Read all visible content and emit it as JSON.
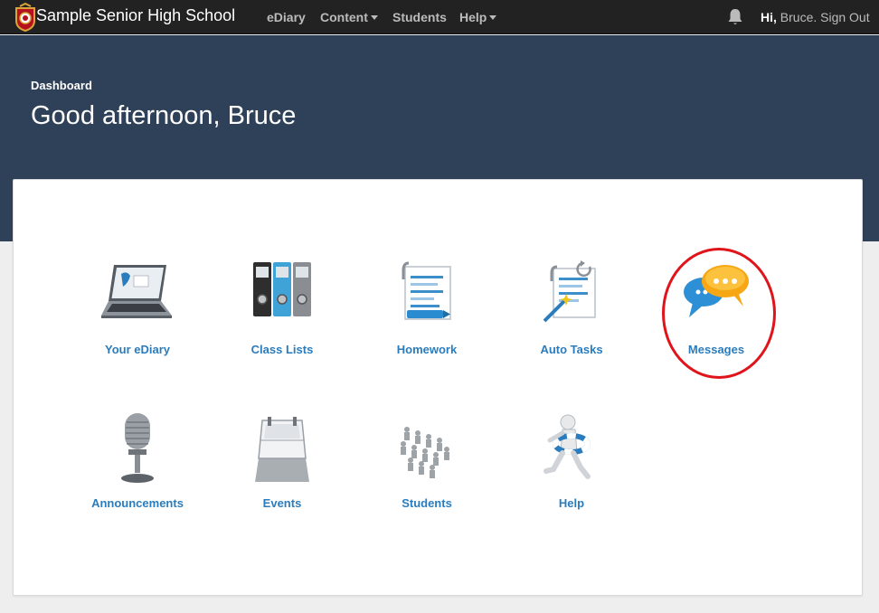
{
  "navbar": {
    "brand": "Sample Senior High School",
    "items": [
      {
        "label": "eDiary",
        "has_caret": false
      },
      {
        "label": "Content",
        "has_caret": true
      },
      {
        "label": "Students",
        "has_caret": false
      },
      {
        "label": "Help",
        "has_caret": true
      }
    ],
    "bell_icon": "bell-icon",
    "greeting_hi": "Hi,",
    "greeting_rest": " Bruce. Sign Out"
  },
  "header": {
    "breadcrumb": "Dashboard",
    "title": "Good afternoon, Bruce"
  },
  "tiles": [
    {
      "label": "Your eDiary",
      "icon": "laptop-icon"
    },
    {
      "label": "Class Lists",
      "icon": "binders-icon"
    },
    {
      "label": "Homework",
      "icon": "document-highlighter-icon"
    },
    {
      "label": "Auto Tasks",
      "icon": "document-wand-icon"
    },
    {
      "label": "Messages",
      "icon": "speech-bubbles-icon"
    },
    {
      "label": "Announcements",
      "icon": "microphone-icon"
    },
    {
      "label": "Events",
      "icon": "flip-calendar-icon"
    },
    {
      "label": "Students",
      "icon": "people-group-icon"
    },
    {
      "label": "Help",
      "icon": "lifebuoy-runner-icon"
    }
  ],
  "colors": {
    "navbar": "#222222",
    "header": "#2f4158",
    "link": "#2a7cbd",
    "highlight": "#e0141b"
  }
}
